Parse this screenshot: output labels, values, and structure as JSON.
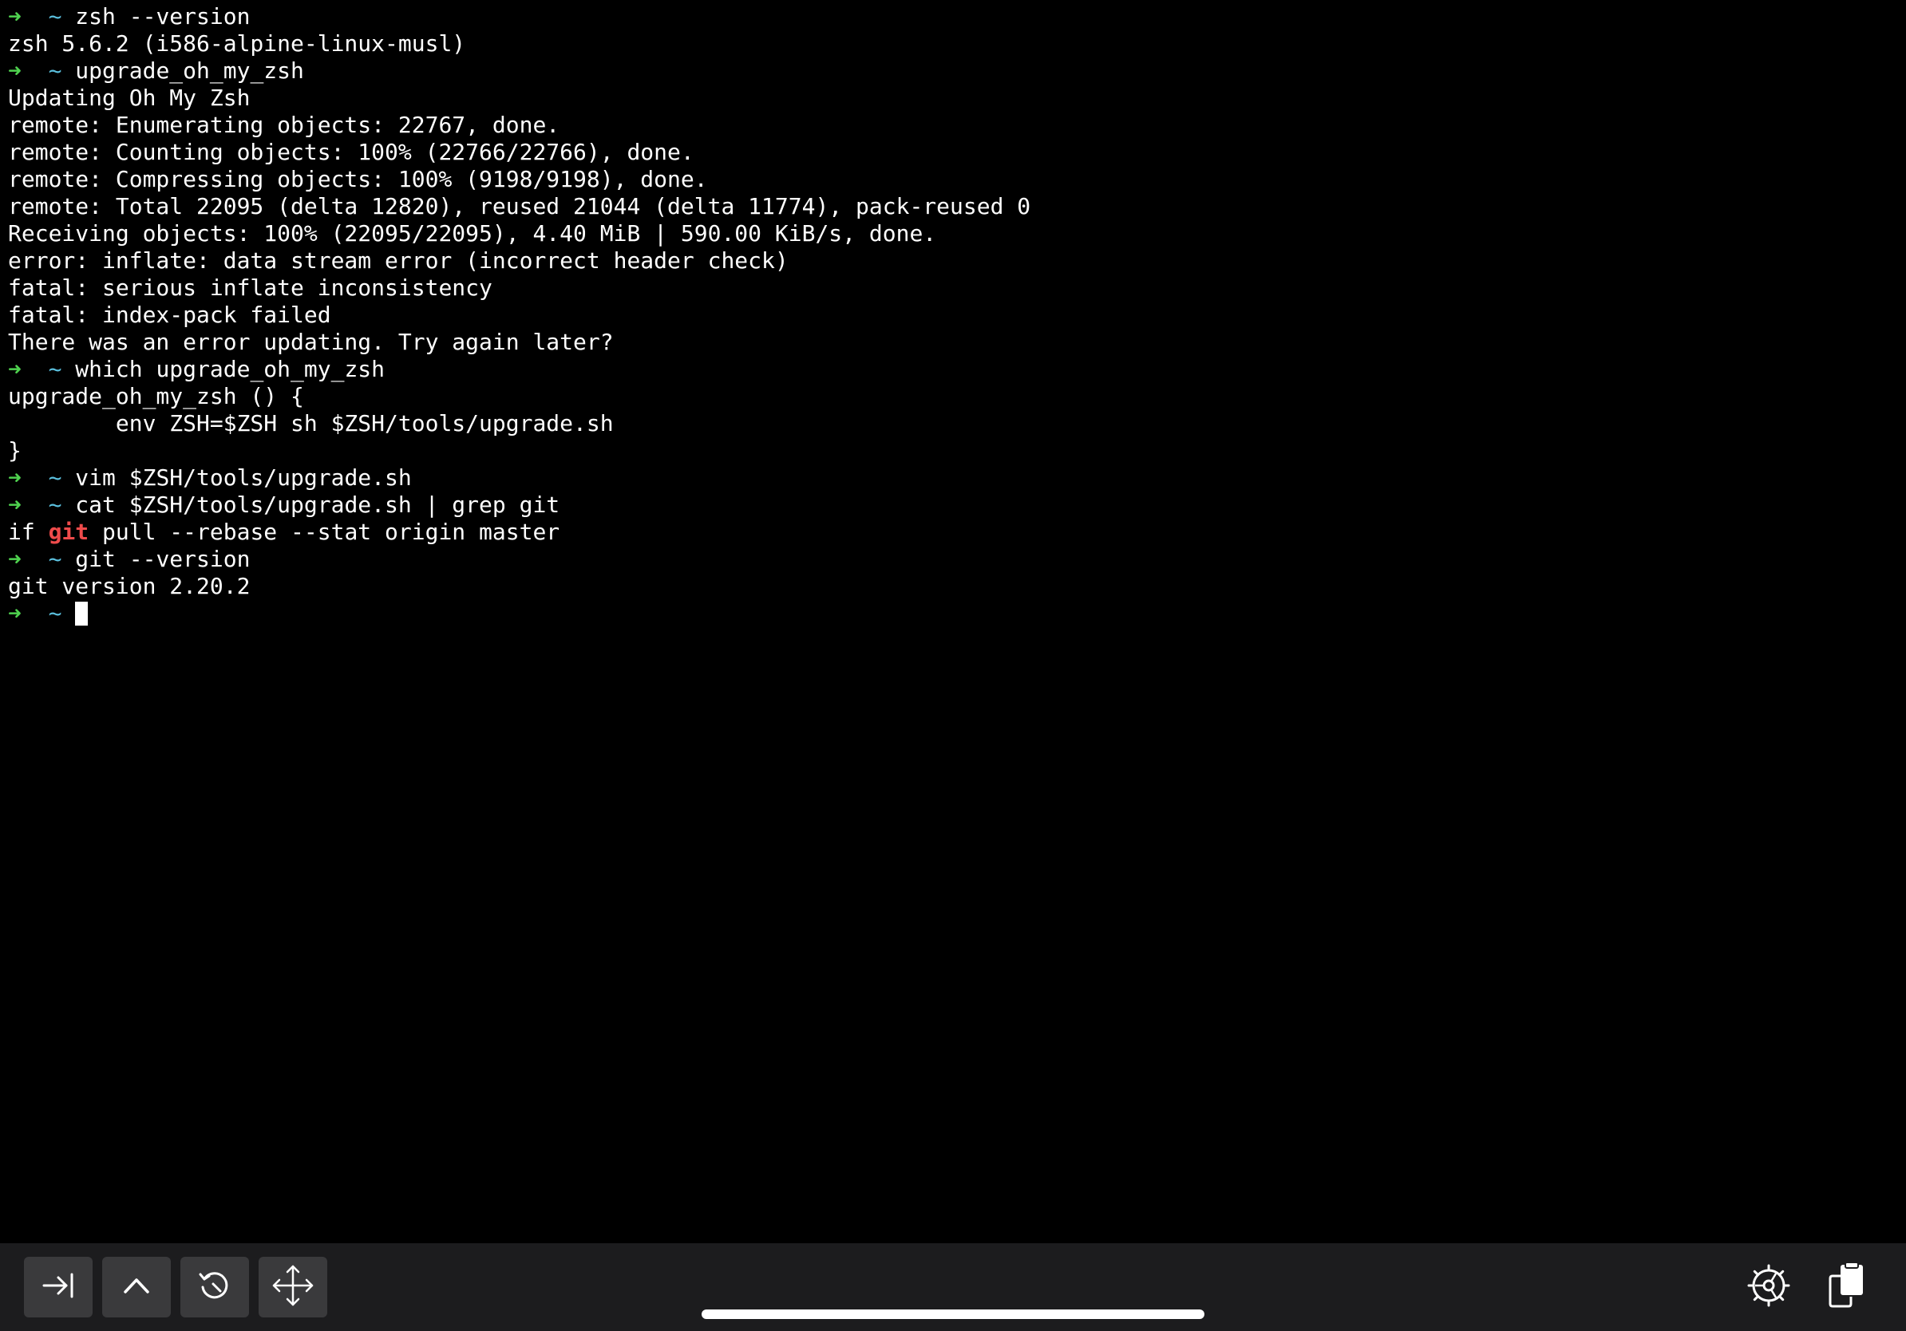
{
  "prompt": {
    "arrow": "➜",
    "dir": "~"
  },
  "terminal": {
    "lines": [
      {
        "kind": "cmd",
        "text": "zsh --version"
      },
      {
        "kind": "out",
        "text": "zsh 5.6.2 (i586-alpine-linux-musl)"
      },
      {
        "kind": "cmd",
        "text": "upgrade_oh_my_zsh"
      },
      {
        "kind": "out",
        "text": "Updating Oh My Zsh"
      },
      {
        "kind": "out",
        "text": "remote: Enumerating objects: 22767, done."
      },
      {
        "kind": "out",
        "text": "remote: Counting objects: 100% (22766/22766), done."
      },
      {
        "kind": "out",
        "text": "remote: Compressing objects: 100% (9198/9198), done."
      },
      {
        "kind": "out",
        "text": "remote: Total 22095 (delta 12820), reused 21044 (delta 11774), pack-reused 0"
      },
      {
        "kind": "out",
        "text": "Receiving objects: 100% (22095/22095), 4.40 MiB | 590.00 KiB/s, done."
      },
      {
        "kind": "out",
        "text": "error: inflate: data stream error (incorrect header check)"
      },
      {
        "kind": "out",
        "text": "fatal: serious inflate inconsistency"
      },
      {
        "kind": "out",
        "text": "fatal: index-pack failed"
      },
      {
        "kind": "out",
        "text": "There was an error updating. Try again later?"
      },
      {
        "kind": "cmd",
        "text": "which upgrade_oh_my_zsh"
      },
      {
        "kind": "out",
        "text": "upgrade_oh_my_zsh () {"
      },
      {
        "kind": "out",
        "text": "        env ZSH=$ZSH sh $ZSH/tools/upgrade.sh"
      },
      {
        "kind": "out",
        "text": "}"
      },
      {
        "kind": "cmd",
        "text": "vim $ZSH/tools/upgrade.sh"
      },
      {
        "kind": "cmd",
        "text": "cat $ZSH/tools/upgrade.sh | grep git"
      },
      {
        "kind": "grep",
        "before": "if ",
        "match": "git",
        "after": " pull --rebase --stat origin master"
      },
      {
        "kind": "cmd",
        "text": "git --version"
      },
      {
        "kind": "out",
        "text": "git version 2.20.2"
      },
      {
        "kind": "input",
        "text": ""
      }
    ]
  },
  "toolbar": {
    "buttons": [
      {
        "name": "tab-key-button",
        "icon": "tab-arrow-icon"
      },
      {
        "name": "control-key-button",
        "icon": "caret-up-icon"
      },
      {
        "name": "history-button",
        "icon": "history-icon"
      },
      {
        "name": "arrow-keys-button",
        "icon": "move-arrows-icon"
      }
    ],
    "right_icons": [
      {
        "name": "settings-button",
        "icon": "gear-icon"
      },
      {
        "name": "paste-button",
        "icon": "clipboard-icon"
      }
    ]
  },
  "colors": {
    "background": "#000000",
    "text": "#ffffff",
    "prompt_arrow": "#4fd24f",
    "prompt_dir": "#5bc0de",
    "grep_match": "#ef4b4b",
    "toolbar_bg": "#1c1c1e",
    "button_bg": "#3a3a3c"
  }
}
